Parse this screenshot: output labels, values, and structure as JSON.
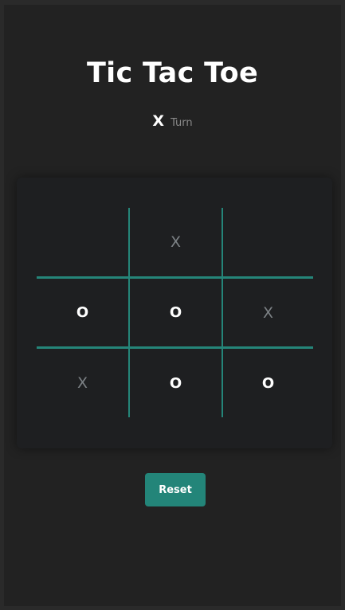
{
  "title": "Tic Tac Toe",
  "turn": {
    "player": "X",
    "label": "Turn"
  },
  "board": {
    "cells": [
      "",
      "X",
      "",
      "O",
      "O",
      "X",
      "X",
      "O",
      "O"
    ]
  },
  "reset_label": "Reset",
  "colors": {
    "background": "#222222",
    "board_background": "#1e1f21",
    "grid_line": "#258579",
    "button": "#238579",
    "x_mark": "#7c8185",
    "o_mark": "#ffffff"
  }
}
